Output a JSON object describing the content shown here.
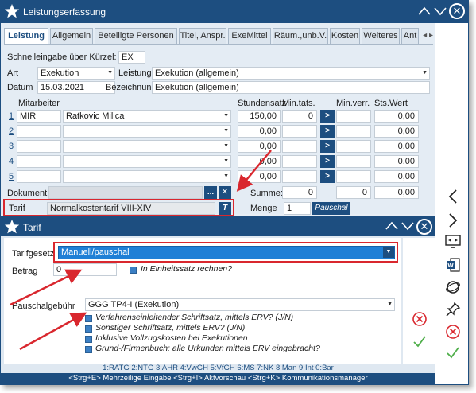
{
  "window": {
    "title": "Leistungserfassung"
  },
  "tabs": [
    "Leistung",
    "Allgemein",
    "Beteiligte Personen",
    "Titel, Anspr.",
    "ExeMittel",
    "Räum.,unb.V.",
    "Kosten",
    "Weiteres",
    "Ant"
  ],
  "form": {
    "schnell_label": "Schnelleingabe über Kürzel:",
    "schnell_value": "EX",
    "art_label": "Art",
    "art_value": "Exekution",
    "leistung_label": "Leistung",
    "leistung_value": "Exekution (allgemein)",
    "datum_label": "Datum",
    "datum_value": "15.03.2021",
    "bezeichnung_label": "Bezeichnung",
    "bezeichnung_value": "Exekution (allgemein)"
  },
  "grid": {
    "headers": {
      "mitarbeiter": "Mitarbeiter",
      "stundensatz": "Stundensatz",
      "mintats": "Min.tats.",
      "minverr": "Min.verr.",
      "stswert": "Sts.Wert"
    },
    "rows": [
      {
        "num": "1",
        "code": "MIR",
        "name": "Ratkovic Milica",
        "satz": "150,00",
        "min": "0",
        "wert": "0,00"
      },
      {
        "num": "2",
        "code": "",
        "name": "",
        "satz": "0,00",
        "min": "",
        "wert": "0,00"
      },
      {
        "num": "3",
        "code": "",
        "name": "",
        "satz": "0,00",
        "min": "",
        "wert": "0,00"
      },
      {
        "num": "4",
        "code": "",
        "name": "",
        "satz": "0,00",
        "min": "",
        "wert": "0,00"
      },
      {
        "num": "5",
        "code": "",
        "name": "",
        "satz": "0,00",
        "min": "",
        "wert": "0,00"
      }
    ],
    "arrow": ">"
  },
  "bottom": {
    "dokument_label": "Dokument",
    "summe_label": "Summe:",
    "summe_min": "0",
    "summe_verr": "0",
    "summe_wert": "0,00",
    "tarif_label": "Tarif",
    "tarif_value": "Normalkostentarif VIII-XIV",
    "tarif_btn": "T",
    "menge_label": "Menge",
    "menge_value": "1",
    "pauschal_label": "Pauschal",
    "doc_btn": "..."
  },
  "dialog": {
    "title": "Tarif",
    "tarifgesetz_label": "Tarifgesetz",
    "tarifgesetz_value": "Manuell/pauschal",
    "betrag_label": "Betrag",
    "betrag_value": "0",
    "einheitssatz_label": "In Einheitssatz rechnen?",
    "pauschal_label": "Pauschalgebühr",
    "pauschal_value": "GGG TP4-I (Exekution)",
    "checks": [
      "Verfahrenseinleitender Schriftsatz, mittels ERV? (J/N)",
      "Sonstiger Schriftsatz, mittels ERV? (J/N)",
      "Inklusive Vollzugskosten bei Exekutionen",
      "Grund-/Firmenbuch: alle Urkunden mittels ERV eingebracht?"
    ],
    "ratg": "1:RATG 2:NTG 3:AHR 4:VwGH 5:VfGH 6:MS 7:NK 8:Man 9:Int 0:Bar",
    "shortcuts": "<Strg+E> Mehrzeilige Eingabe <Strg+I> Aktvorschau <Strg+K> Kommunikationsmanager"
  },
  "colors": {
    "brand": "#1d4e80",
    "annotation": "#d9272e",
    "accent": "#3b7fc4"
  }
}
